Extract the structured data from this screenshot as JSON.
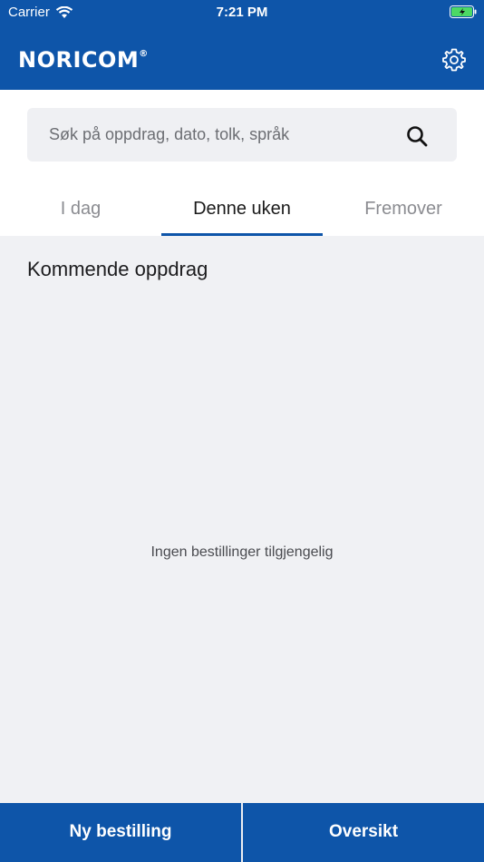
{
  "status_bar": {
    "carrier": "Carrier",
    "time": "7:21 PM"
  },
  "header": {
    "logo_text": "NORICOM",
    "logo_mark": "®",
    "settings_icon": "gear-icon",
    "background_color": "#0e55a9"
  },
  "search": {
    "placeholder": "Søk på oppdrag, dato, tolk, språk",
    "value": "",
    "icon": "search-icon"
  },
  "tabs": [
    {
      "label": "I dag",
      "active": false
    },
    {
      "label": "Denne uken",
      "active": true
    },
    {
      "label": "Fremover",
      "active": false
    }
  ],
  "main": {
    "section_title": "Kommende oppdrag",
    "empty_message": "Ingen bestillinger tilgjengelig"
  },
  "bottom_bar": {
    "new_order_label": "Ny bestilling",
    "overview_label": "Oversikt"
  }
}
